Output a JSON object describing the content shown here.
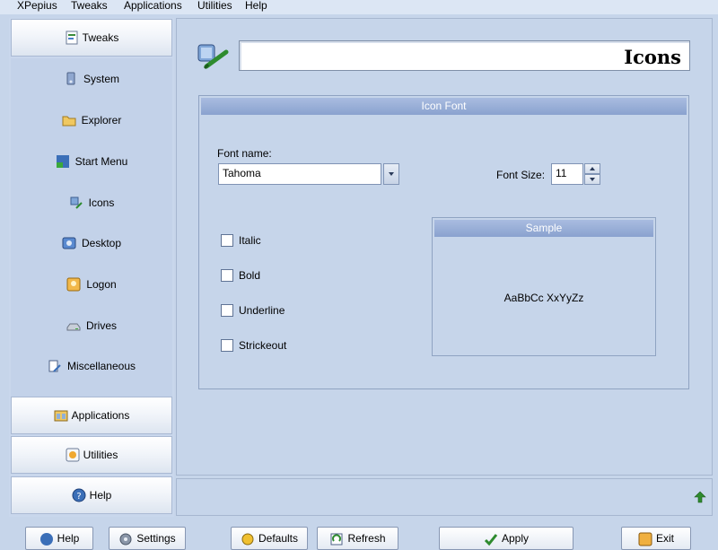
{
  "menubar": {
    "items": [
      "XPepius",
      "Tweaks",
      "Applications",
      "Utilities",
      "Help"
    ]
  },
  "sidebar": {
    "tweaks_header": "Tweaks",
    "items": [
      "System",
      "Explorer",
      "Start Menu",
      "Icons",
      "Desktop",
      "Logon",
      "Drives",
      "Miscellaneous"
    ],
    "applications_header": "Applications",
    "utilities_header": "Utilities",
    "help_header": "Help"
  },
  "main": {
    "title": "Icons",
    "icon_font_group": {
      "title": "Icon Font",
      "font_name_label": "Font name:",
      "font_name_value": "Tahoma",
      "font_size_label": "Font Size:",
      "font_size_value": "11",
      "checkboxes": [
        {
          "label": "Italic",
          "checked": false
        },
        {
          "label": "Bold",
          "checked": false
        },
        {
          "label": "Underline",
          "checked": false
        },
        {
          "label": "Strickeout",
          "checked": false
        }
      ],
      "sample": {
        "title": "Sample",
        "text": "AaBbCc XxYyZz"
      }
    }
  },
  "bottom_buttons": [
    "Help",
    "Settings",
    "Defaults",
    "Refresh",
    "Apply",
    "Exit"
  ],
  "colors": {
    "background": "#c6d5ea",
    "group_header": "#8aa2cf",
    "accent_green": "#2e8b2e"
  }
}
